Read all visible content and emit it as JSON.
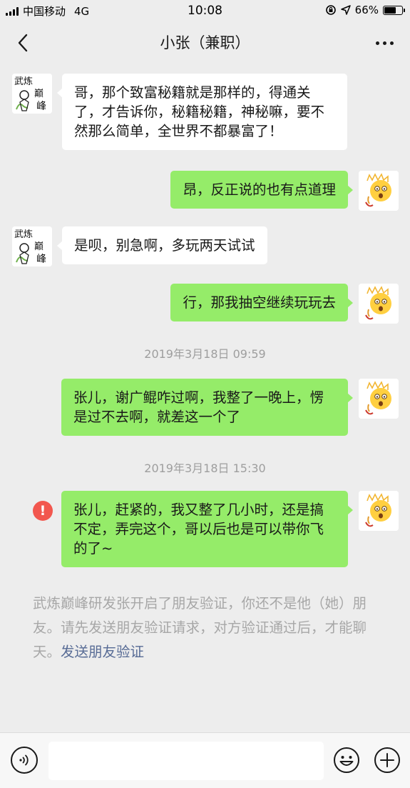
{
  "status_bar": {
    "carrier": "中国移动",
    "network": "4G",
    "time": "10:08",
    "battery_text": "66%",
    "battery_level": 0.66
  },
  "header": {
    "title": "小张（兼职）"
  },
  "messages": [
    {
      "side": "in",
      "text": "哥，那个致富秘籍就是那样的，得通关了，才告诉你，秘籍秘籍，神秘嘛，要不然那么简单，全世界不都暴富了！"
    },
    {
      "side": "out",
      "text": "昂，反正说的也有点道理"
    },
    {
      "side": "in",
      "text": "是呗，别急啊，多玩两天试试"
    },
    {
      "side": "out",
      "text": "行，那我抽空继续玩玩去"
    },
    {
      "side": "out",
      "text": "张儿，谢广鲲咋过啊，我整了一晚上，愣是过不去啊，就差这一个了"
    },
    {
      "side": "out",
      "text": "张儿，赶紧的，我又整了几小时，还是搞不定，弄完这个，哥以后也是可以带你飞的了~",
      "failed": true
    }
  ],
  "timestamps": [
    "2019年3月18日 09:59",
    "2019年3月18日 15:30"
  ],
  "system_notice": {
    "text": "武炼巅峰研发张开启了朋友验证，你还不是他（她）朋友。请先发送朋友验证请求，对方验证通过后，才能聊天。",
    "link": "发送朋友验证"
  },
  "friend_avatar_text": [
    "武炼",
    "巅",
    "峰"
  ],
  "fail_mark": "!",
  "colors": {
    "background": "#ededed",
    "bubble_out": "#95ec69",
    "bubble_in": "#ffffff",
    "timestamp": "#9e9e9e",
    "link": "#576b95",
    "error": "#f2574e"
  }
}
